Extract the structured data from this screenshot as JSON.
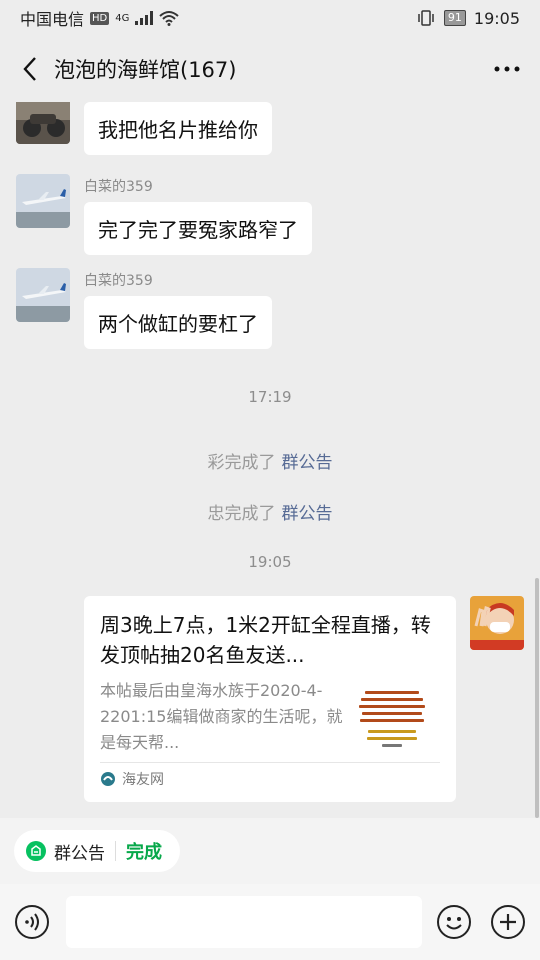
{
  "status_bar": {
    "carrier": "中国电信",
    "network_badge": "HD",
    "network_type": "4G",
    "battery": "91",
    "time": "19:05"
  },
  "header": {
    "title": "泡泡的海鲜馆(167)"
  },
  "messages": [
    {
      "sender": "",
      "text": "我把他名片推给你",
      "avatar": "motorcycle-avatar"
    },
    {
      "sender": "白菜的359",
      "text": "完了完了要冤家路窄了",
      "avatar": "airplane-avatar"
    },
    {
      "sender": "白菜的359",
      "text": "两个做缸的要杠了",
      "avatar": "airplane-avatar"
    }
  ],
  "timestamps": [
    "17:19",
    "19:05"
  ],
  "system_notices": [
    {
      "text": "彩完成了",
      "link": "群公告"
    },
    {
      "text": "忠完成了",
      "link": "群公告"
    }
  ],
  "link_card": {
    "title": "周3晚上7点，1米2开缸全程直播，转发顶帖抽20名鱼友送...",
    "description": "本帖最后由皇海水族于2020-4-2201:15编辑做商家的生活呢，就是每天帮...",
    "source": "海友网"
  },
  "pinned_notice": {
    "label": "群公告",
    "action": "完成"
  },
  "colors": {
    "background": "#ededed",
    "link": "#576b95",
    "done": "#07a84a"
  }
}
